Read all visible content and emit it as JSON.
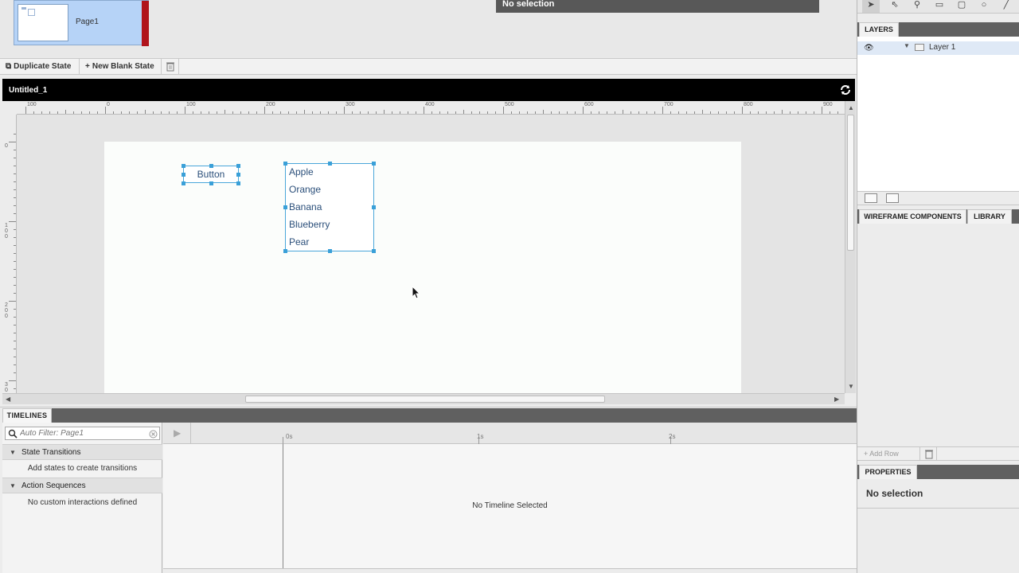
{
  "pages": {
    "items": [
      {
        "label": "Page1"
      }
    ],
    "selection_banner": "No selection"
  },
  "state_toolbar": {
    "duplicate_label": "Duplicate State",
    "new_blank_label": "New Blank State"
  },
  "document": {
    "title": "Untitled_1"
  },
  "rulers": {
    "horizontal": [
      "100",
      "0",
      "100",
      "200",
      "300",
      "400",
      "500",
      "600",
      "700",
      "800",
      "900"
    ],
    "vertical": [
      "0",
      "100",
      "200",
      "300"
    ]
  },
  "canvas": {
    "button_label": "Button",
    "list_items": [
      "Apple",
      "Orange",
      "Banana",
      "Blueberry",
      "Pear"
    ]
  },
  "timelines": {
    "tab_label": "TIMELINES",
    "filter_placeholder": "Auto Filter: Page1",
    "sections": [
      {
        "label": "State Transitions",
        "message": "Add states to create transitions"
      },
      {
        "label": "Action Sequences",
        "message": "No custom interactions defined"
      }
    ],
    "time_marks": [
      "0s",
      "1s",
      "2s"
    ],
    "empty_message": "No Timeline Selected"
  },
  "right_panel": {
    "layers_tab": "LAYERS",
    "layers": [
      {
        "name": "Layer 1"
      }
    ],
    "components_tab": "WIREFRAME COMPONENTS",
    "library_tab": "LIBRARY",
    "add_row_label": "Add Row",
    "properties_tab": "PROPERTIES",
    "properties_empty": "No selection"
  },
  "colors": {
    "selection_accent": "#3aa0d8",
    "page_thumb_bg": "#b6d3f7",
    "page_flag": "#b0141c",
    "doc_header": "#000000",
    "tab_strip": "#606060"
  }
}
